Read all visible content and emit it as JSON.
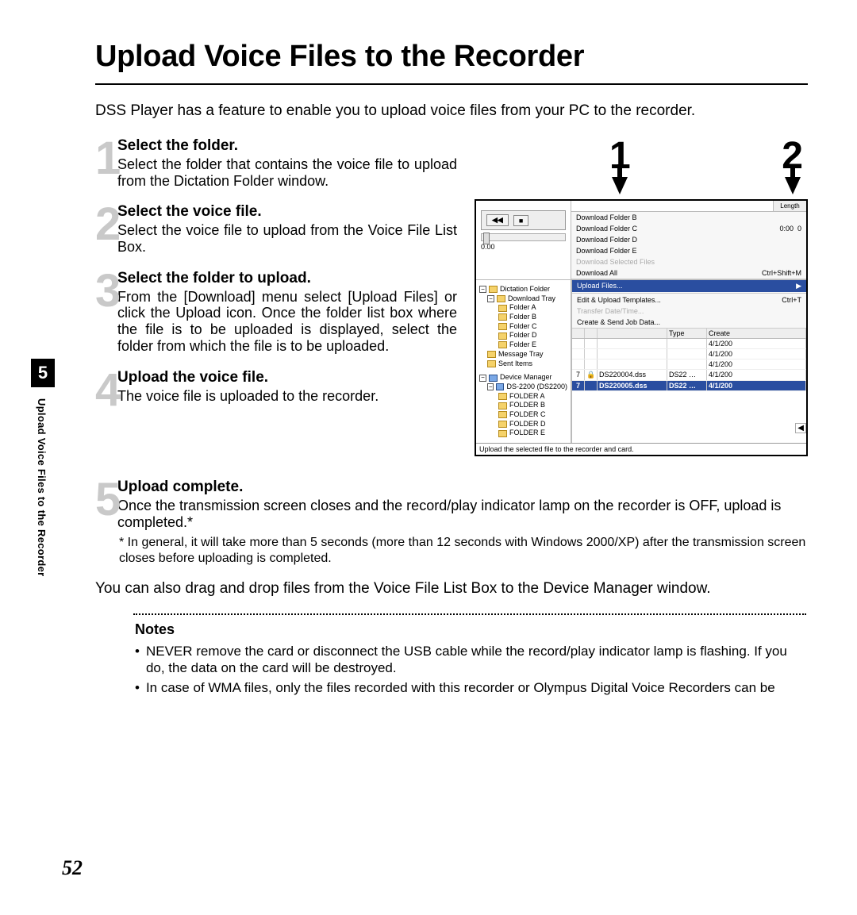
{
  "page": {
    "title": "Upload Voice Files to the Recorder",
    "intro": "DSS Player has a feature to enable you to upload voice files from your PC to the recorder.",
    "drag_drop": "You can also drag and drop files from the Voice File List Box to the Device Manager window.",
    "footnote_1": "* In general, it will take more than 5 seconds (more than 12 seconds with Windows 2000/XP) after the transmission screen closes before uploading is completed.",
    "notes_heading": "Notes",
    "notes": [
      "NEVER remove the card or disconnect the USB cable while the record/play indicator lamp is flashing. If you do, the data on the card will be destroyed.",
      "In case of WMA files, only the files recorded with this recorder or Olympus Digital Voice Recorders can be"
    ],
    "page_number": "52",
    "chapter_number": "5",
    "side_label": "Upload Voice Files to the Recorder"
  },
  "callouts": {
    "c1": "1",
    "c2": "2"
  },
  "steps": {
    "s1": {
      "num": "1",
      "title": "Select the folder.",
      "body": "Select the folder that contains the voice file to upload from the Dictation Folder window."
    },
    "s2": {
      "num": "2",
      "title": "Select the voice file.",
      "body": "Select the voice file to upload from the Voice File List Box."
    },
    "s3": {
      "num": "3",
      "title": "Select the folder to upload.",
      "body": "From the [Download] menu select [Upload Files] or click the Upload icon. Once the folder list box where the file is to be uploaded is displayed, select the folder from which the file is to be uploaded."
    },
    "s4": {
      "num": "4",
      "title": "Upload the voice file.",
      "body": "The voice file is uploaded to the recorder."
    },
    "s5": {
      "num": "5",
      "title": "Upload complete.",
      "body": "Once the transmission screen closes and the record/play indicator lamp on the recorder is OFF, upload is completed.*"
    }
  },
  "app": {
    "timecode": "0.00",
    "length_label": "Length",
    "length_val": "0:00",
    "bitrate": "0",
    "menu": {
      "dl_b": "Download Folder B",
      "dl_c": "Download Folder C",
      "dl_d": "Download Folder D",
      "dl_e": "Download Folder E",
      "dl_sel": "Download Selected Files",
      "dl_all": "Download All",
      "dl_all_sc": "Ctrl+Shift+M",
      "upload": "Upload Files...",
      "tmpl": "Edit & Upload Templates...",
      "tmpl_sc": "Ctrl+T",
      "datetime": "Transfer Date/Time...",
      "jobdata": "Create & Send Job Data..."
    },
    "tree": {
      "dict": "Dictation Folder",
      "dtray": "Download Tray",
      "fa": "Folder A",
      "fb": "Folder B",
      "fc": "Folder C",
      "fd": "Folder D",
      "fe": "Folder E",
      "mtray": "Message Tray",
      "sent": "Sent Items",
      "devmgr": "Device Manager",
      "device": "DS-2200 (DS2200)",
      "dfa": "FOLDER A",
      "dfb": "FOLDER B",
      "dfc": "FOLDER C",
      "dfd": "FOLDER D",
      "dfe": "FOLDER E"
    },
    "filelist": {
      "h_type": "Type",
      "h_create": "Create",
      "rows": [
        {
          "ln": " ",
          "file": "",
          "date": "4/1/200"
        },
        {
          "ln": " ",
          "file": "",
          "date": "4/1/200"
        },
        {
          "ln": " ",
          "file": "",
          "date": "4/1/200"
        },
        {
          "ln": "7",
          "lock": "🔒",
          "file": "DS220004.dss",
          "type": "DS22 …",
          "date": "4/1/200"
        },
        {
          "ln": "7",
          "lock": "",
          "file": "DS220005.dss",
          "type": "DS22 …",
          "date": "4/1/200"
        }
      ]
    },
    "statusbar": "Upload the selected file to the recorder and card."
  }
}
